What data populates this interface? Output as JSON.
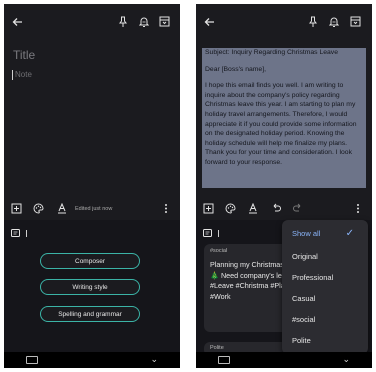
{
  "left": {
    "title_placeholder": "Title",
    "note_placeholder": "Note",
    "edited_text": "Edited just now",
    "ai_buttons": [
      "Composer",
      "Writing style",
      "Spelling and grammar"
    ]
  },
  "right": {
    "email_paragraphs": [
      "Subject: Inquiry Regarding Christmas Leave",
      "Dear [Boss's name],",
      "I hope this email finds you well. I am writing to inquire about the company's policy regarding Christmas leave this year. I am starting to plan my holiday travel arrangements. Therefore, I would appreciate it if you could provide some information on the designated holiday period. Knowing the holiday schedule will help me finalize my plans. Thank you for your time and consideration. I look forward to your response."
    ],
    "card_tag": "#social",
    "card_text": "Planning my Christmas travel! ✈️🎄 Need company's leave p #Leave #Christma #Planning #Work",
    "card2_tag": "Polite",
    "menu": {
      "show_all": "Show all",
      "items": [
        "Original",
        "Professional",
        "Casual",
        "#social",
        "Polite"
      ]
    }
  },
  "colors": {
    "background": "#1b1b1f",
    "accent_teal": "#3bb3a6",
    "selection": "#6d7489",
    "menu_accent": "#8ab4f8"
  },
  "icons": [
    "back-arrow-icon",
    "pin-icon",
    "reminder-bell-icon",
    "archive-icon",
    "add-box-icon",
    "palette-icon",
    "text-format-icon",
    "undo-icon",
    "redo-icon",
    "more-vert-icon",
    "ai-assist-icon",
    "keyboard-icon",
    "chevron-down-icon",
    "check-icon",
    "chevron-up-icon"
  ]
}
